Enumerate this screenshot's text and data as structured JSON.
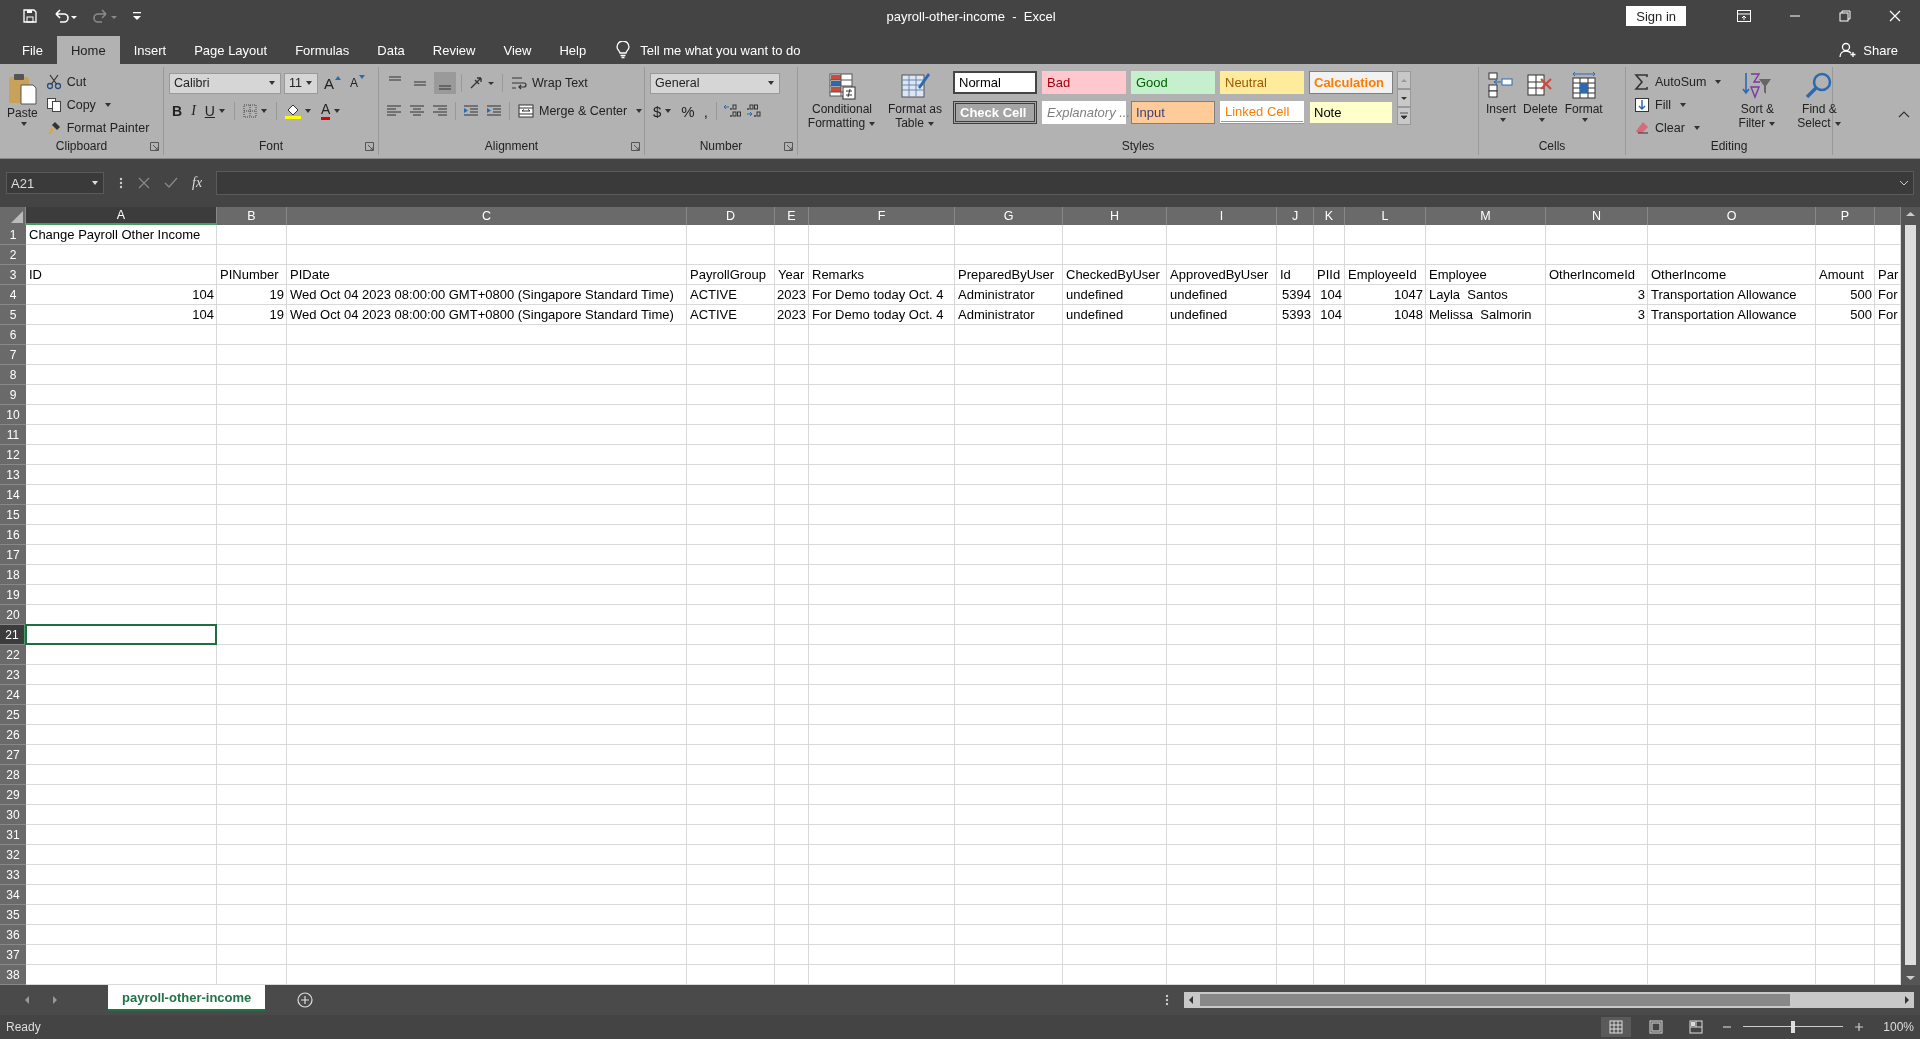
{
  "title_bar": {
    "title": "payroll-other-income  -  Excel",
    "sign_in": "Sign in"
  },
  "ribbon_tabs": [
    {
      "label": "File",
      "selected": false
    },
    {
      "label": "Home",
      "selected": true
    },
    {
      "label": "Insert",
      "selected": false
    },
    {
      "label": "Page Layout",
      "selected": false
    },
    {
      "label": "Formulas",
      "selected": false
    },
    {
      "label": "Data",
      "selected": false
    },
    {
      "label": "Review",
      "selected": false
    },
    {
      "label": "View",
      "selected": false
    },
    {
      "label": "Help",
      "selected": false
    }
  ],
  "tell_me": "Tell me what you want to do",
  "share": "Share",
  "clipboard": {
    "label": "Clipboard",
    "paste": "Paste",
    "cut": "Cut",
    "copy": "Copy",
    "format_painter": "Format Painter"
  },
  "font": {
    "label": "Font",
    "name": "Calibri",
    "size": "11",
    "grow": "A",
    "shrink": "A",
    "bold": "B",
    "italic": "I",
    "underline": "U",
    "font_color": "A"
  },
  "alignment": {
    "label": "Alignment",
    "wrap_text": "Wrap Text",
    "merge_center": "Merge & Center"
  },
  "number": {
    "label": "Number",
    "format": "General",
    "currency": "$",
    "percent": "%",
    "comma": ","
  },
  "styles": {
    "label": "Styles",
    "conditional_formatting": "Conditional Formatting",
    "format_as_table": "Format as Table",
    "gallery": [
      {
        "label": "Normal",
        "kind": "normal"
      },
      {
        "label": "Bad",
        "kind": "bad"
      },
      {
        "label": "Good",
        "kind": "good"
      },
      {
        "label": "Neutral",
        "kind": "neutral"
      },
      {
        "label": "Calculation",
        "kind": "calculation"
      },
      {
        "label": "Check Cell",
        "kind": "check"
      },
      {
        "label": "Explanatory ...",
        "kind": "explanatory"
      },
      {
        "label": "Input",
        "kind": "input"
      },
      {
        "label": "Linked Cell",
        "kind": "linked"
      },
      {
        "label": "Note",
        "kind": "note"
      }
    ]
  },
  "cells": {
    "label": "Cells",
    "insert": "Insert",
    "delete": "Delete",
    "format": "Format"
  },
  "editing": {
    "label": "Editing",
    "autosum": "AutoSum",
    "fill": "Fill",
    "clear": "Clear",
    "sort_filter": "Sort & Filter",
    "find_select": "Find & Select"
  },
  "formula_bar": {
    "name_box": "A21",
    "function": "fx"
  },
  "sheet": {
    "columns": [
      {
        "letter": "A",
        "selected": true
      },
      {
        "letter": "B",
        "selected": false
      },
      {
        "letter": "C",
        "selected": false
      },
      {
        "letter": "D",
        "selected": false
      },
      {
        "letter": "E",
        "selected": false
      },
      {
        "letter": "F",
        "selected": false
      },
      {
        "letter": "G",
        "selected": false
      },
      {
        "letter": "H",
        "selected": false
      },
      {
        "letter": "I",
        "selected": false
      },
      {
        "letter": "J",
        "selected": false
      },
      {
        "letter": "K",
        "selected": false
      },
      {
        "letter": "L",
        "selected": false
      },
      {
        "letter": "M",
        "selected": false
      },
      {
        "letter": "N",
        "selected": false
      },
      {
        "letter": "O",
        "selected": false
      },
      {
        "letter": "P",
        "selected": false
      },
      {
        "selected": false
      }
    ],
    "rows": [
      {
        "number": "1",
        "selected": false,
        "cells": [
          {
            "text": "Change Payroll Other Income",
            "kind": "text"
          }
        ]
      },
      {
        "number": "2",
        "selected": false
      },
      {
        "number": "3",
        "selected": false,
        "cells": [
          {
            "text": "ID",
            "kind": "text"
          },
          {
            "text": "PINumber",
            "kind": "text"
          },
          {
            "text": "PIDate",
            "kind": "text"
          },
          {
            "text": "PayrollGroup",
            "kind": "text"
          },
          {
            "text": "Year",
            "kind": "text"
          },
          {
            "text": "Remarks",
            "kind": "text"
          },
          {
            "text": "PreparedByUser",
            "kind": "text"
          },
          {
            "text": "CheckedByUser",
            "kind": "text"
          },
          {
            "text": "ApprovedByUser",
            "kind": "text"
          },
          {
            "text": "Id",
            "kind": "text"
          },
          {
            "text": "PIId",
            "kind": "text"
          },
          {
            "text": "EmployeeId",
            "kind": "text"
          },
          {
            "text": "Employee",
            "kind": "text"
          },
          {
            "text": "OtherIncomeId",
            "kind": "text"
          },
          {
            "text": "OtherIncome",
            "kind": "text"
          },
          {
            "text": "Amount",
            "kind": "text"
          },
          {
            "text": "Par",
            "kind": "text"
          }
        ]
      },
      {
        "number": "4",
        "selected": false,
        "cells": [
          {
            "text": "104",
            "kind": "number"
          },
          {
            "text": "19",
            "kind": "number"
          },
          {
            "text": "Wed Oct 04 2023 08:00:00 GMT+0800 (Singapore Standard Time)",
            "kind": "text"
          },
          {
            "text": "ACTIVE",
            "kind": "text"
          },
          {
            "text": "2023",
            "kind": "number"
          },
          {
            "text": "For Demo today Oct. 4",
            "kind": "text"
          },
          {
            "text": "Administrator",
            "kind": "text"
          },
          {
            "text": "undefined",
            "kind": "text"
          },
          {
            "text": "undefined",
            "kind": "text"
          },
          {
            "text": "5394",
            "kind": "number"
          },
          {
            "text": "104",
            "kind": "number"
          },
          {
            "text": "1047",
            "kind": "number"
          },
          {
            "text": "Layla  Santos",
            "kind": "text"
          },
          {
            "text": "3",
            "kind": "number"
          },
          {
            "text": "Transportation Allowance",
            "kind": "text"
          },
          {
            "text": "500",
            "kind": "number"
          },
          {
            "text": "For",
            "kind": "text"
          }
        ]
      },
      {
        "number": "5",
        "selected": false,
        "cells": [
          {
            "text": "104",
            "kind": "number"
          },
          {
            "text": "19",
            "kind": "number"
          },
          {
            "text": "Wed Oct 04 2023 08:00:00 GMT+0800 (Singapore Standard Time)",
            "kind": "text"
          },
          {
            "text": "ACTIVE",
            "kind": "text"
          },
          {
            "text": "2023",
            "kind": "number"
          },
          {
            "text": "For Demo today Oct. 4",
            "kind": "text"
          },
          {
            "text": "Administrator",
            "kind": "text"
          },
          {
            "text": "undefined",
            "kind": "text"
          },
          {
            "text": "undefined",
            "kind": "text"
          },
          {
            "text": "5393",
            "kind": "number"
          },
          {
            "text": "104",
            "kind": "number"
          },
          {
            "text": "1048",
            "kind": "number"
          },
          {
            "text": "Melissa  Salmorin",
            "kind": "text"
          },
          {
            "text": "3",
            "kind": "number"
          },
          {
            "text": "Transportation Allowance",
            "kind": "text"
          },
          {
            "text": "500",
            "kind": "number"
          },
          {
            "text": "For",
            "kind": "text"
          }
        ]
      },
      {
        "number": "6",
        "selected": false
      },
      {
        "number": "7",
        "selected": false
      },
      {
        "number": "8",
        "selected": false
      },
      {
        "number": "9",
        "selected": false
      },
      {
        "number": "10",
        "selected": false
      },
      {
        "number": "11",
        "selected": false
      },
      {
        "number": "12",
        "selected": false
      },
      {
        "number": "13",
        "selected": false
      },
      {
        "number": "14",
        "selected": false
      },
      {
        "number": "15",
        "selected": false
      },
      {
        "number": "16",
        "selected": false
      },
      {
        "number": "17",
        "selected": false
      },
      {
        "number": "18",
        "selected": false
      },
      {
        "number": "19",
        "selected": false
      },
      {
        "number": "20",
        "selected": false
      },
      {
        "number": "21",
        "selected": true
      },
      {
        "number": "22",
        "selected": false
      },
      {
        "number": "23",
        "selected": false
      },
      {
        "number": "24",
        "selected": false
      },
      {
        "number": "25",
        "selected": false
      },
      {
        "number": "26",
        "selected": false
      },
      {
        "number": "27",
        "selected": false
      },
      {
        "number": "28",
        "selected": false
      },
      {
        "number": "29",
        "selected": false
      },
      {
        "number": "30",
        "selected": false
      },
      {
        "number": "31",
        "selected": false
      },
      {
        "number": "32",
        "selected": false
      },
      {
        "number": "33",
        "selected": false
      },
      {
        "number": "34",
        "selected": false
      },
      {
        "number": "35",
        "selected": false
      },
      {
        "number": "36",
        "selected": false
      },
      {
        "number": "37",
        "selected": false
      },
      {
        "number": "38",
        "selected": false
      }
    ]
  },
  "sheet_tabs": [
    {
      "label": "payroll-other-income",
      "selected": true
    }
  ],
  "status_bar": {
    "status": "Ready",
    "zoom": "100%",
    "zoom_slider": {
      "level": 0.5
    }
  }
}
